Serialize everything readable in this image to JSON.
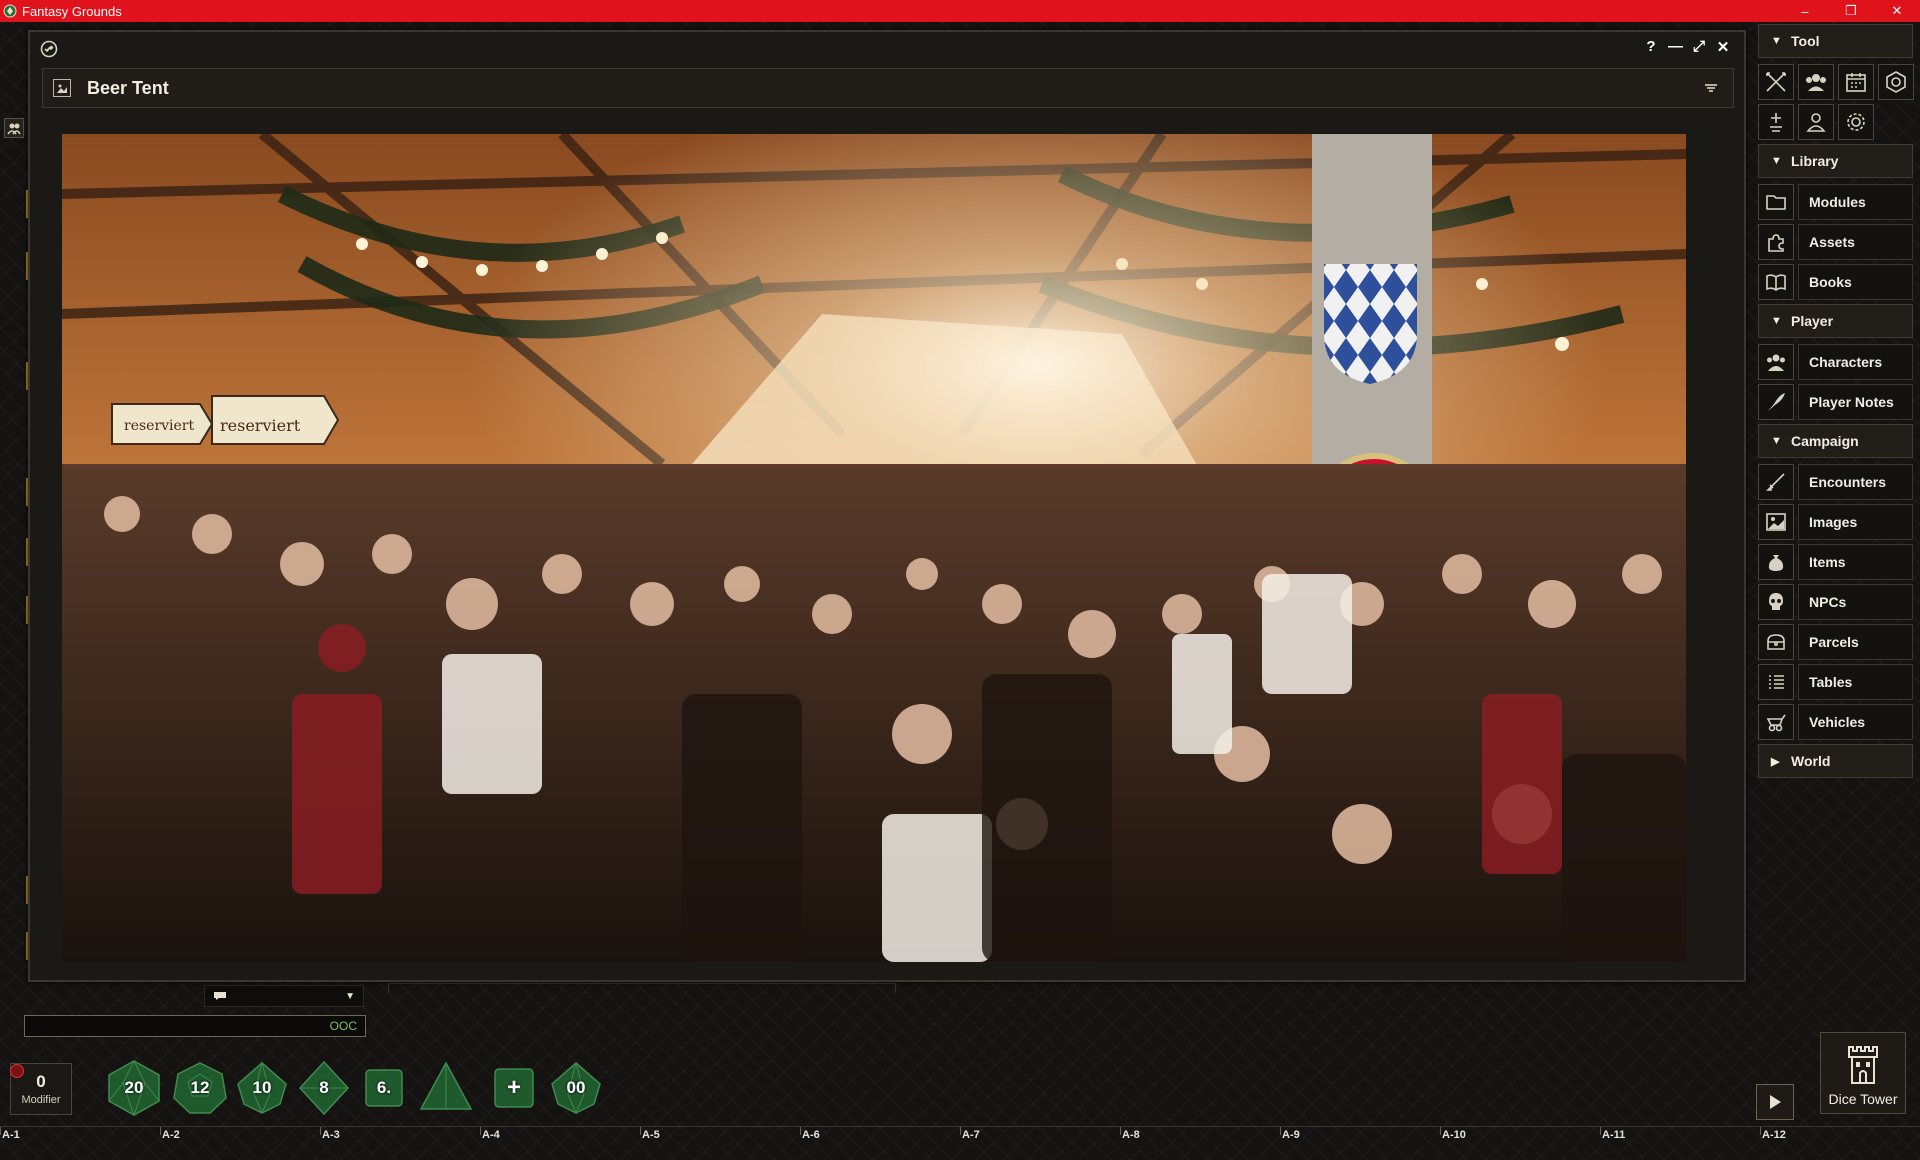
{
  "os": {
    "title": "Fantasy Grounds",
    "controls": [
      "–",
      "❐",
      "✕"
    ]
  },
  "image_window": {
    "title": "Beer Tent",
    "controls": [
      "?",
      "—",
      "⤢",
      "✕"
    ],
    "image_description_icon": "image-icon"
  },
  "sidebar": {
    "tool_header": "Tool",
    "tool_icons": [
      "combat-tracker-icon",
      "party-sheet-icon",
      "calendar-icon",
      "effects-icon",
      "light-icon",
      "user-icon",
      "options-icon"
    ],
    "library_header": "Library",
    "library_items": [
      {
        "label": "Modules",
        "icon": "folder-icon"
      },
      {
        "label": "Assets",
        "icon": "puzzle-icon"
      },
      {
        "label": "Books",
        "icon": "book-icon"
      }
    ],
    "player_header": "Player",
    "player_items": [
      {
        "label": "Characters",
        "icon": "characters-icon"
      },
      {
        "label": "Player Notes",
        "icon": "quill-icon"
      }
    ],
    "campaign_header": "Campaign",
    "campaign_items": [
      {
        "label": "Encounters",
        "icon": "sword-icon"
      },
      {
        "label": "Images",
        "icon": "image-icon"
      },
      {
        "label": "Items",
        "icon": "bag-icon"
      },
      {
        "label": "NPCs",
        "icon": "skull-icon"
      },
      {
        "label": "Parcels",
        "icon": "chest-icon"
      },
      {
        "label": "Tables",
        "icon": "list-icon"
      },
      {
        "label": "Vehicles",
        "icon": "cart-icon"
      }
    ],
    "world_header": "World"
  },
  "chat": {
    "mode_icon": "speech-icon",
    "input_value": "OOC"
  },
  "modifier": {
    "value": "0",
    "label": "Modifier"
  },
  "dice": [
    {
      "name": "d20",
      "label": "20"
    },
    {
      "name": "d12",
      "label": "12"
    },
    {
      "name": "d10",
      "label": "10"
    },
    {
      "name": "d8",
      "label": "8"
    },
    {
      "name": "d6",
      "label": "6."
    },
    {
      "name": "d4",
      "label": ""
    },
    {
      "name": "custom",
      "label": "+"
    },
    {
      "name": "d100",
      "label": "00"
    }
  ],
  "dice_tower": {
    "label": "Dice Tower"
  },
  "grid": {
    "labels": [
      "A-1",
      "A-2",
      "A-3",
      "A-4",
      "A-5",
      "A-6",
      "A-7",
      "A-8",
      "A-9",
      "A-10",
      "A-11",
      "A-12"
    ]
  },
  "colors": {
    "titlebar": "#e0121c",
    "panel": "#1b1916",
    "dice_green": "#1f5a2c",
    "accent_gold": "#b8842a",
    "ooc_text": "#7fbf6a"
  }
}
